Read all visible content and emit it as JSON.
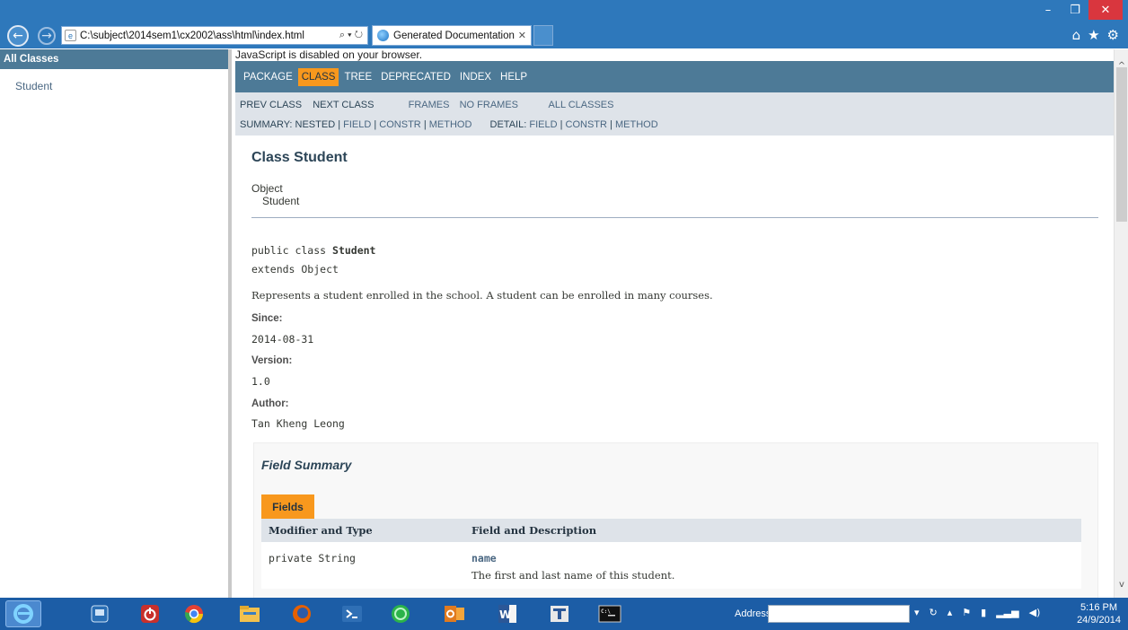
{
  "window": {
    "minimize_glyph": "–",
    "restore_glyph": "❐",
    "close_glyph": "✕"
  },
  "browser": {
    "back_glyph": "←",
    "forward_glyph": "→",
    "address_value": "C:\\subject\\2014sem1\\cx2002\\ass\\html\\index.html",
    "address_tools": "⌕ ▾ ↻",
    "tab_title": "Generated Documentation ...",
    "tab_close_glyph": "✕",
    "home_glyph": "⌂",
    "favorites_glyph": "★",
    "settings_glyph": "⚙"
  },
  "left_frame": {
    "header": "All Classes",
    "classes": [
      "Student"
    ]
  },
  "doc": {
    "noscript": "JavaScript is disabled on your browser.",
    "topnav": [
      "Package",
      "Class",
      "Tree",
      "Deprecated",
      "Index",
      "Help"
    ],
    "topnav_active": "Class",
    "subnav": {
      "prev_class": "PREV CLASS",
      "next_class": "NEXT CLASS",
      "frames": "FRAMES",
      "no_frames": "NO FRAMES",
      "all_classes": "ALL CLASSES",
      "summary_prefix": "SUMMARY: NESTED |",
      "summary_field": "FIELD",
      "summary_constr": "CONSTR",
      "summary_method": "METHOD",
      "detail_prefix": "DETAIL:",
      "detail_field": "FIELD",
      "detail_constr": "CONSTR",
      "detail_method": "METHOD",
      "pipe": "|"
    },
    "class_title": "Class Student",
    "inheritance": [
      "Object",
      "Student"
    ],
    "signature_line1_prefix": "public class ",
    "signature_line1_name": "Student",
    "signature_line2": "extends Object",
    "description": "Represents a student enrolled in the school. A student can be enrolled in many courses.",
    "since_label": "Since:",
    "since_value": "2014-08-31",
    "version_label": "Version:",
    "version_value": "1.0",
    "author_label": "Author:",
    "author_value": "Tan Kheng Leong",
    "field_summary": {
      "title": "Field Summary",
      "tab_label": "Fields",
      "columns": [
        "Modifier and Type",
        "Field and Description"
      ],
      "rows": [
        {
          "type": "private String",
          "name": "name",
          "description": "The first and last name of this student."
        }
      ]
    }
  },
  "scrollbar": {
    "up_glyph": "^",
    "down_glyph": "v"
  },
  "taskbar": {
    "apps": [
      "Internet Explorer",
      "Desktop",
      "Power",
      "Chrome",
      "File Explorer",
      "Firefox",
      "PowerShell",
      "Spotify",
      "Outlook",
      "Word",
      "Editor",
      "Command Prompt"
    ],
    "address_label": "Address",
    "time": "5:16 PM",
    "date": "24/9/2014"
  }
}
